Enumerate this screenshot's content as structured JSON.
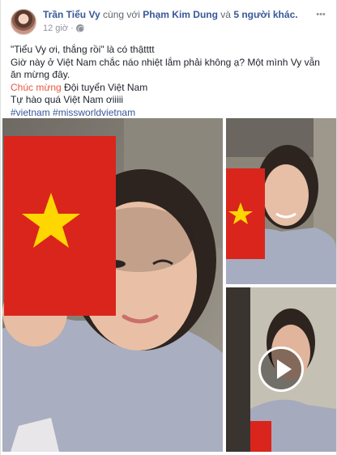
{
  "post": {
    "author": "Trần Tiểu Vy",
    "with_text": "cùng với",
    "tagged": "Phạm Kim Dung",
    "and_text": "và",
    "others": "5 người khác.",
    "time": "12 giờ",
    "separator": "·",
    "line1": "\"Tiểu Vy ơi, thắng rồi\" là có thậtttt",
    "line2": "Giờ này ở Việt Nam chắc náo nhiệt lắm phải không ạ? Một mình Vy vẫn ăn mừng đây.",
    "line3_highlight": "Chúc mừng",
    "line3_rest": " Đội tuyển Việt Nam",
    "line4": "Tự hào quá Việt Nam ơiiiii",
    "hashtag1": "#vietnam",
    "hashtag2": "#missworldvietnam"
  },
  "icons": {
    "avatar": "profile-avatar",
    "privacy": "globe-icon",
    "more": "more-options-icon",
    "video": "play-icon"
  },
  "colors": {
    "link": "#385898",
    "meta": "#90949c",
    "highlight": "#e9573e",
    "flag_red": "#da251d",
    "flag_star": "#ffd700"
  }
}
